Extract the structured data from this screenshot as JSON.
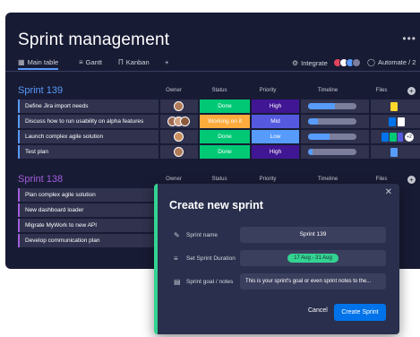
{
  "board": {
    "title": "Sprint management",
    "more_icon": "more-dots-icon",
    "tabs": [
      {
        "label": "Main table",
        "icon": "table-icon"
      },
      {
        "label": "Gantt",
        "icon": "gantt-icon"
      },
      {
        "label": "Kanban",
        "icon": "kanban-icon"
      },
      {
        "label": "+",
        "icon": "add-view-icon"
      }
    ],
    "integrate_label": "Integrate",
    "automate_label": "Automate / 2",
    "columns": [
      "Owner",
      "Status",
      "Priority",
      "Timeline",
      "Files"
    ]
  },
  "groups": [
    {
      "title": "Sprint 139",
      "color": "#579bfc",
      "rows": [
        {
          "name": "Define Jira import needs",
          "status": "Done",
          "status_color": "#00c875",
          "priority": "High",
          "priority_color": "#401694",
          "timeline": 0.55
        },
        {
          "name": "Discuss how to run usability on alpha features",
          "status": "Working on it",
          "status_color": "#fdab3d",
          "priority": "Mid",
          "priority_color": "#5559df",
          "timeline": 0.2
        },
        {
          "name": "Launch complex agile solution",
          "status": "Done",
          "status_color": "#00c875",
          "priority": "Low",
          "priority_color": "#579bfc",
          "timeline": 0.45
        },
        {
          "name": "Test plan",
          "status": "Done",
          "status_color": "#00c875",
          "priority": "High",
          "priority_color": "#401694",
          "timeline": 0.1
        }
      ]
    },
    {
      "title": "Sprint 138",
      "color": "#a25ddc",
      "rows": [
        {
          "name": "Plan complex agile solution"
        },
        {
          "name": "New dashboard loader"
        },
        {
          "name": "Migrate MyWork to new API"
        },
        {
          "name": "Develop communication plan"
        }
      ]
    }
  ],
  "modal": {
    "title": "Create new sprint",
    "close_icon": "close-icon",
    "fields": [
      {
        "label": "Sprint name",
        "icon": "pencil-icon",
        "value": "Sprint 139"
      },
      {
        "label": "Set Sprint Duration",
        "icon": "duration-icon",
        "value": "17 Aug - 31 Aug"
      },
      {
        "label": "Sprint goal / notes",
        "icon": "notes-icon",
        "value": "This is your sprint's goal or even sprint notes to the..."
      }
    ],
    "cancel_label": "Cancel",
    "create_label": "Create Sprint",
    "accent": "#33d391"
  },
  "files_extra_count": "+2"
}
